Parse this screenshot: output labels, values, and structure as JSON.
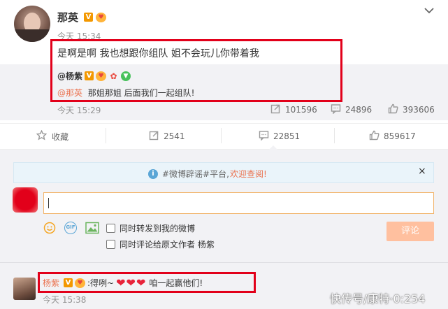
{
  "post": {
    "author": "那英",
    "time": "今天 15:34",
    "text": "是啊是啊 我也想跟你组队 姐不会玩儿你带着我",
    "quoted": {
      "author": "@杨紫",
      "mention": "@那英",
      "text": "那姐那姐 后面我们一起组队!",
      "time": "今天 15:29",
      "reposts": "101596",
      "comments": "24896",
      "likes": "393606"
    }
  },
  "actions": {
    "favorite": "收藏",
    "repost": "2541",
    "comment": "22851",
    "like": "859617"
  },
  "notice": {
    "prefix": "#微博辟谣#平台,",
    "link": "欢迎查阅!",
    "close": "×"
  },
  "composer": {
    "input_value": "",
    "option1": "同时转发到我的微博",
    "option2": "同时评论给原文作者 杨紫",
    "submit": "评论"
  },
  "reply": {
    "author": "杨紫",
    "text_before": ":得咧~",
    "text_after": "咱一起赢他们!",
    "time": "今天 15:38",
    "watermark": "快传号/康特·0:254"
  },
  "colors": {
    "accent": "#eb7350",
    "highlight_box": "#e2001a",
    "verified": "#f39800"
  }
}
